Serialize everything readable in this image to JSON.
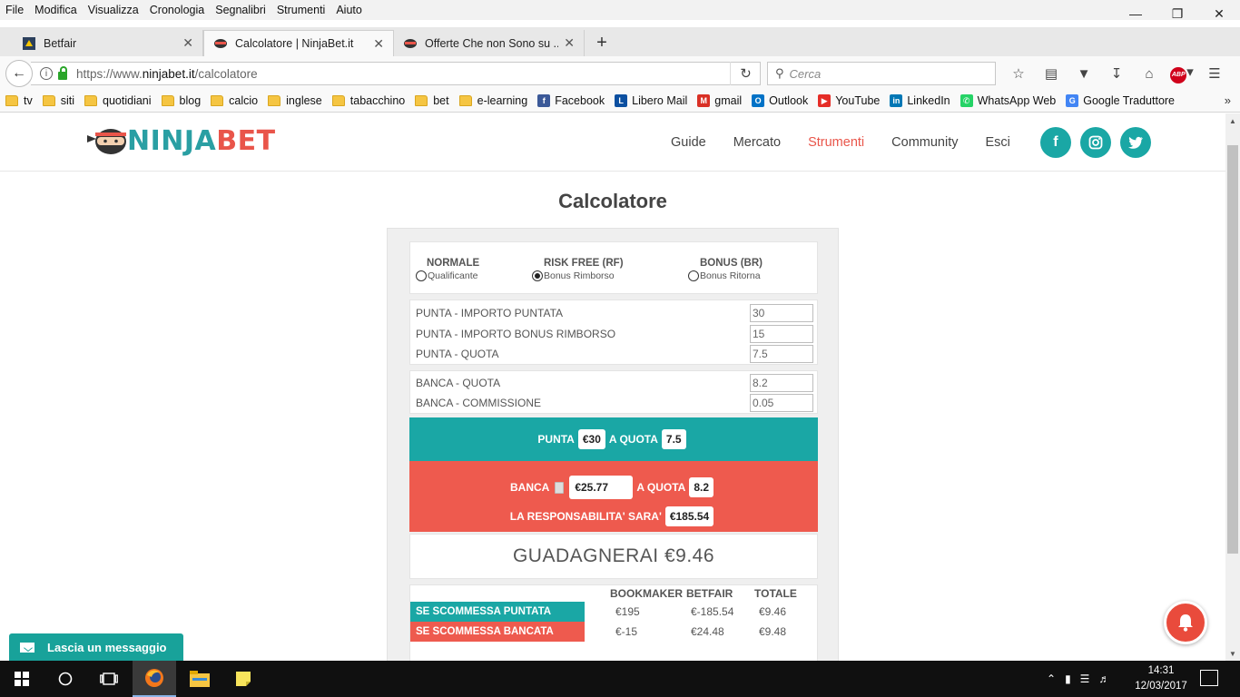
{
  "menubar": {
    "items": [
      "File",
      "Modifica",
      "Visualizza",
      "Cronologia",
      "Segnalibri",
      "Strumenti",
      "Aiuto"
    ]
  },
  "tabs": [
    {
      "label": "Betfair",
      "active": false
    },
    {
      "label": "Calcolatore | NinjaBet.it",
      "active": true
    },
    {
      "label": "Offerte Che non Sono su ...",
      "active": false
    }
  ],
  "navbar": {
    "url_prefix": "https://www.",
    "url_domain": "ninjabet.it",
    "url_path": "/calcolatore",
    "search_placeholder": "Cerca"
  },
  "bookmarks": [
    {
      "label": "tv",
      "type": "folder"
    },
    {
      "label": "siti",
      "type": "folder"
    },
    {
      "label": "quotidiani",
      "type": "folder"
    },
    {
      "label": "blog",
      "type": "folder"
    },
    {
      "label": "calcio",
      "type": "folder"
    },
    {
      "label": "inglese",
      "type": "folder"
    },
    {
      "label": "tabacchino",
      "type": "folder"
    },
    {
      "label": "bet",
      "type": "folder"
    },
    {
      "label": "e-learning",
      "type": "folder"
    },
    {
      "label": "Facebook",
      "type": "facebook",
      "color": "#3b5998"
    },
    {
      "label": "Libero Mail",
      "type": "libero",
      "color": "#0b4fa0"
    },
    {
      "label": "gmail",
      "type": "gmail",
      "color": "#d93025"
    },
    {
      "label": "Outlook",
      "type": "outlook",
      "color": "#0072c6"
    },
    {
      "label": "YouTube",
      "type": "youtube",
      "color": "#e52d27"
    },
    {
      "label": "LinkedIn",
      "type": "linkedin",
      "color": "#0077b5"
    },
    {
      "label": "WhatsApp Web",
      "type": "whatsapp",
      "color": "#25d366"
    },
    {
      "label": "Google Traduttore",
      "type": "translate",
      "color": "#4285f4"
    }
  ],
  "site": {
    "logo_part1": "NINJA",
    "logo_part2": "BET",
    "nav": [
      {
        "label": "Guide",
        "active": false
      },
      {
        "label": "Mercato",
        "active": false
      },
      {
        "label": "Strumenti",
        "active": true
      },
      {
        "label": "Community",
        "active": false
      },
      {
        "label": "Esci",
        "active": false
      }
    ],
    "social": [
      "facebook-icon",
      "instagram-icon",
      "twitter-icon"
    ],
    "accent_color": "#1aa7a5",
    "active_color": "#e9554a"
  },
  "page": {
    "title": "Calcolatore"
  },
  "calc": {
    "modes": [
      {
        "title": "NORMALE",
        "sub": "Qualificante",
        "checked": false
      },
      {
        "title": "RISK FREE (RF)",
        "sub": "Bonus Rimborso",
        "checked": true
      },
      {
        "title": "BONUS (BR)",
        "sub": "Bonus Ritorna",
        "checked": false
      }
    ],
    "punta_fields": [
      {
        "label": "PUNTA - IMPORTO PUNTATA",
        "value": "30"
      },
      {
        "label": "PUNTA - IMPORTO BONUS RIMBORSO",
        "value": "15"
      },
      {
        "label": "PUNTA - QUOTA",
        "value": "7.5"
      }
    ],
    "banca_fields": [
      {
        "label": "BANCA - QUOTA",
        "value": "8.2"
      },
      {
        "label": "BANCA - COMMISSIONE",
        "value": "0.05"
      }
    ],
    "punta_summary": {
      "prefix": "PUNTA",
      "amount": "€30",
      "mid": "A QUOTA",
      "odds": "7.5"
    },
    "banca_summary": {
      "prefix": "BANCA",
      "amount": "€25.77",
      "mid": "A QUOTA",
      "odds": "8.2"
    },
    "liability": {
      "label": "LA RESPONSABILITA' SARA'",
      "value": "€185.54"
    },
    "profit": "GUADAGNERAI €9.46",
    "results": {
      "headers": [
        "BOOKMAKER",
        "BETFAIR",
        "TOTALE"
      ],
      "rows": [
        {
          "label": "SE SCOMMESSA PUNTATA VINCE",
          "color": "#1aa7a5",
          "values": [
            "€195",
            "€-185.54",
            "€9.46"
          ]
        },
        {
          "label": "SE SCOMMESSA BANCATA VINCE",
          "color": "#ee5a4e",
          "values": [
            "€-15",
            "€24.48",
            "€9.48"
          ]
        }
      ]
    }
  },
  "chat": {
    "label": "Lascia un messaggio"
  },
  "taskbar": {
    "time": "14:31",
    "date": "12/03/2017"
  }
}
